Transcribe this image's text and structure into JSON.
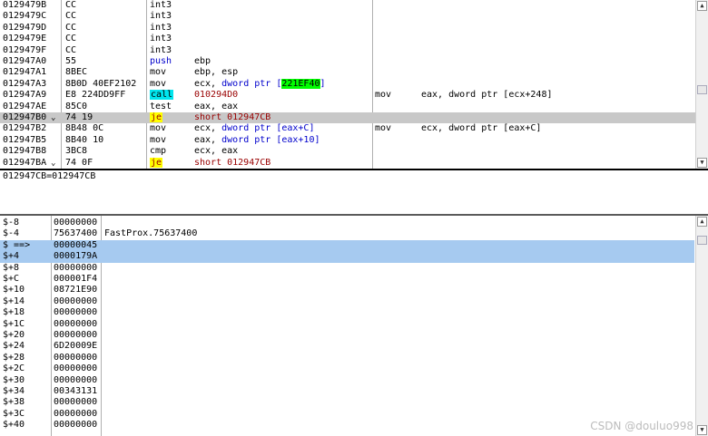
{
  "disasm_rows": [
    {
      "addr": "0129479B",
      "bytes": "CC",
      "mnemonic": "int3",
      "operand": "",
      "comment": "",
      "comment2": ""
    },
    {
      "addr": "0129479C",
      "bytes": "CC",
      "mnemonic": "int3",
      "operand": "",
      "comment": "",
      "comment2": ""
    },
    {
      "addr": "0129479D",
      "bytes": "CC",
      "mnemonic": "int3",
      "operand": "",
      "comment": "",
      "comment2": ""
    },
    {
      "addr": "0129479E",
      "bytes": "CC",
      "mnemonic": "int3",
      "operand": "",
      "comment": "",
      "comment2": ""
    },
    {
      "addr": "0129479F",
      "bytes": "CC",
      "mnemonic": "int3",
      "operand": "",
      "comment": "",
      "comment2": ""
    },
    {
      "addr": "012947A0",
      "bytes": "55",
      "mnemonic": "push",
      "operand": "ebp",
      "comment": "",
      "comment2": ""
    },
    {
      "addr": "012947A1",
      "bytes": "8BEC",
      "mnemonic": "mov",
      "operand": "ebp, esp",
      "comment": "",
      "comment2": ""
    },
    {
      "addr": "012947A3",
      "bytes": "8B0D 40EF2102",
      "mnemonic": "mov",
      "operand_pre": "ecx, ",
      "operand_kw": "dword ptr",
      "operand_open": " [",
      "operand_hl": "221EF40",
      "operand_close": "]",
      "comment": "",
      "comment2": ""
    },
    {
      "addr": "012947A9",
      "bytes": "E8 224DD9FF",
      "mnemonic": "call",
      "operand": "010294D0",
      "comment": "mov",
      "comment2": "eax, dword ptr [ecx+248]"
    },
    {
      "addr": "012947AE",
      "bytes": "85C0",
      "mnemonic": "test",
      "operand": "eax, eax",
      "comment": "",
      "comment2": ""
    },
    {
      "addr": "012947B0",
      "mark": "⌄",
      "bytes": "74 19",
      "mnemonic": "je",
      "operand": "short 012947CB",
      "comment": "",
      "comment2": ""
    },
    {
      "addr": "012947B2",
      "bytes": "8B48 0C",
      "mnemonic": "mov",
      "operand_pre": "ecx, ",
      "operand_kw": "dword ptr",
      "operand_open": " [eax+C]",
      "comment": "mov",
      "comment2": "ecx, dword ptr [eax+C]"
    },
    {
      "addr": "012947B5",
      "bytes": "8B40 10",
      "mnemonic": "mov",
      "operand_pre": "eax, ",
      "operand_kw": "dword ptr",
      "operand_open": " [eax+10]",
      "comment": "",
      "comment2": ""
    },
    {
      "addr": "012947B8",
      "bytes": "3BC8",
      "mnemonic": "cmp",
      "operand": "ecx, eax",
      "comment": "",
      "comment2": ""
    },
    {
      "addr": "012947BA",
      "mark": "⌄",
      "bytes": "74 0F",
      "mnemonic": "je",
      "operand": "short 012947CB",
      "comment": "",
      "comment2": ""
    }
  ],
  "info_text": "012947CB=012947CB",
  "stack_rows": [
    {
      "offset": "$-8",
      "value": "00000000",
      "comment": ""
    },
    {
      "offset": "$-4",
      "value": "75637400",
      "comment": "FastProx.75637400"
    },
    {
      "offset": "$ ==>",
      "value": "00000045",
      "comment": ""
    },
    {
      "offset": "$+4",
      "value": "0000179A",
      "comment": ""
    },
    {
      "offset": "$+8",
      "value": "00000000",
      "comment": ""
    },
    {
      "offset": "$+C",
      "value": "000001F4",
      "comment": ""
    },
    {
      "offset": "$+10",
      "value": "08721E90",
      "comment": ""
    },
    {
      "offset": "$+14",
      "value": "00000000",
      "comment": ""
    },
    {
      "offset": "$+18",
      "value": "00000000",
      "comment": ""
    },
    {
      "offset": "$+1C",
      "value": "00000000",
      "comment": ""
    },
    {
      "offset": "$+20",
      "value": "00000000",
      "comment": ""
    },
    {
      "offset": "$+24",
      "value": "6D20009E",
      "comment": ""
    },
    {
      "offset": "$+28",
      "value": "00000000",
      "comment": ""
    },
    {
      "offset": "$+2C",
      "value": "00000000",
      "comment": ""
    },
    {
      "offset": "$+30",
      "value": "00000000",
      "comment": ""
    },
    {
      "offset": "$+34",
      "value": "00343131",
      "comment": ""
    },
    {
      "offset": "$+38",
      "value": "00000000",
      "comment": ""
    },
    {
      "offset": "$+3C",
      "value": "00000000",
      "comment": ""
    },
    {
      "offset": "$+40",
      "value": "00000000",
      "comment": ""
    }
  ],
  "selected_disasm_addr": "012947B0",
  "selected_stack_offsets": [
    "$ ==>",
    "$+4"
  ],
  "watermark": "CSDN @douluo998",
  "colors": {
    "selection": "#c8c8c8",
    "stack_selection": "#a6caf0",
    "call_highlight": "#00e5ee",
    "je_highlight": "#ffff00",
    "address_highlight": "#00ff00",
    "keyword": "#0000cc",
    "target": "#990000"
  }
}
